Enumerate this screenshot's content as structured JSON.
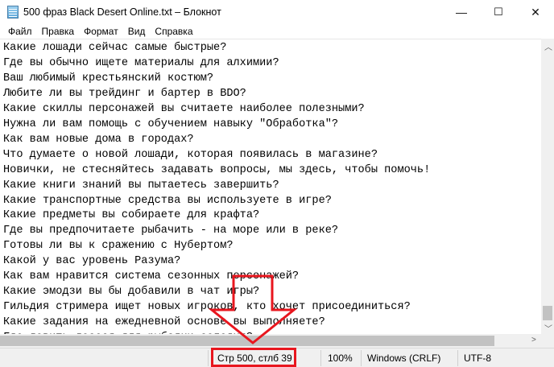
{
  "window": {
    "title": "500 фраз Black Desert Online.txt – Блокнот",
    "minimize": "—",
    "maximize": "☐",
    "close": "✕"
  },
  "menu": [
    "Файл",
    "Правка",
    "Формат",
    "Вид",
    "Справка"
  ],
  "lines": [
    "Какие лошади сейчас самые быстрые?",
    "Где вы обычно ищете материалы для алхимии?",
    "Ваш любимый крестьянский костюм?",
    "Любите ли вы трейдинг и бартер в BDO?",
    "Какие скиллы персонажей вы считаете наиболее полезными?",
    "Нужна ли вам помощь с обучением навыку \"Обработка\"?",
    "Как вам новые дома в городах?",
    "Что думаете о новой лошади, которая появилась в магазине?",
    "Новички, не стесняйтесь задавать вопросы, мы здесь, чтобы помочь!",
    "Какие книги знаний вы пытаетесь завершить?",
    "Какие транспортные средства вы используете в игре?",
    "Какие предметы вы собираете для крафта?",
    "Где вы предпочитаете рыбачить - на море или в реке?",
    "Готовы ли вы к сражению с Нубертом?",
    "Какой у вас уровень Разума?",
    "Как вам нравится система сезонных персонажей?",
    "Какие эмодзи вы бы добавили в чат игры?",
    "Гильдия стримера ищет новых игроков, кто хочет присоединиться?",
    "Какие задания на ежедневной основе вы выполняете?",
    "Где ловить лосося для рыбалки сегодня?"
  ],
  "status": {
    "position": "Стр 500, стлб 39",
    "zoom": "100%",
    "line_ending": "Windows (CRLF)",
    "encoding": "UTF-8"
  },
  "annotation_color": "#e8161e"
}
